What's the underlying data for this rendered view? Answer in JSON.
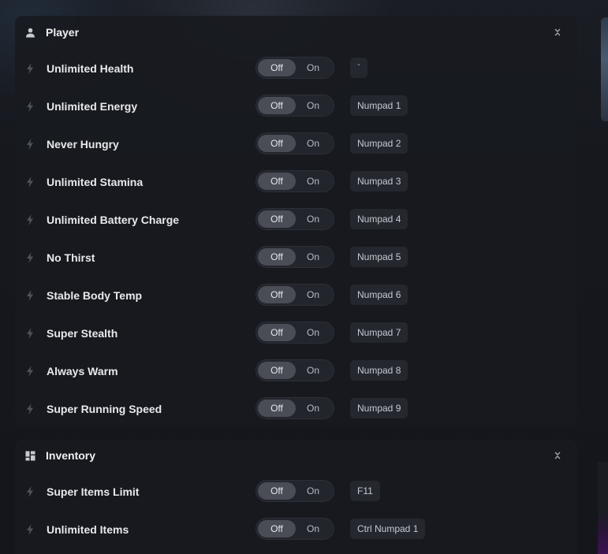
{
  "sections": [
    {
      "title": "Player",
      "icon": "person-icon",
      "collapse_icon": "collapse-chevrons-icon",
      "rows": [
        {
          "label": "Unlimited Health",
          "off": "Off",
          "on": "On",
          "state": "Off",
          "hotkey": "`"
        },
        {
          "label": "Unlimited Energy",
          "off": "Off",
          "on": "On",
          "state": "Off",
          "hotkey": "Numpad 1"
        },
        {
          "label": "Never Hungry",
          "off": "Off",
          "on": "On",
          "state": "Off",
          "hotkey": "Numpad 2"
        },
        {
          "label": "Unlimited Stamina",
          "off": "Off",
          "on": "On",
          "state": "Off",
          "hotkey": "Numpad 3"
        },
        {
          "label": "Unlimited Battery Charge",
          "off": "Off",
          "on": "On",
          "state": "Off",
          "hotkey": "Numpad 4"
        },
        {
          "label": "No Thirst",
          "off": "Off",
          "on": "On",
          "state": "Off",
          "hotkey": "Numpad 5"
        },
        {
          "label": "Stable Body Temp",
          "off": "Off",
          "on": "On",
          "state": "Off",
          "hotkey": "Numpad 6"
        },
        {
          "label": "Super Stealth",
          "off": "Off",
          "on": "On",
          "state": "Off",
          "hotkey": "Numpad 7"
        },
        {
          "label": "Always Warm",
          "off": "Off",
          "on": "On",
          "state": "Off",
          "hotkey": "Numpad 8"
        },
        {
          "label": "Super Running Speed",
          "off": "Off",
          "on": "On",
          "state": "Off",
          "hotkey": "Numpad 9"
        }
      ]
    },
    {
      "title": "Inventory",
      "icon": "dashboard-grid-icon",
      "collapse_icon": "collapse-chevrons-icon",
      "rows": [
        {
          "label": "Super Items Limit",
          "off": "Off",
          "on": "On",
          "state": "Off",
          "hotkey": "F11"
        },
        {
          "label": "Unlimited Items",
          "off": "Off",
          "on": "On",
          "state": "Off",
          "hotkey": "Ctrl Numpad 1"
        }
      ]
    }
  ],
  "row_icon": "bolt-icon",
  "colors": {
    "background": "#15171d",
    "card": "#181a20",
    "toggle_active": "#4a4d56",
    "hotkey_bg": "#24272e"
  }
}
